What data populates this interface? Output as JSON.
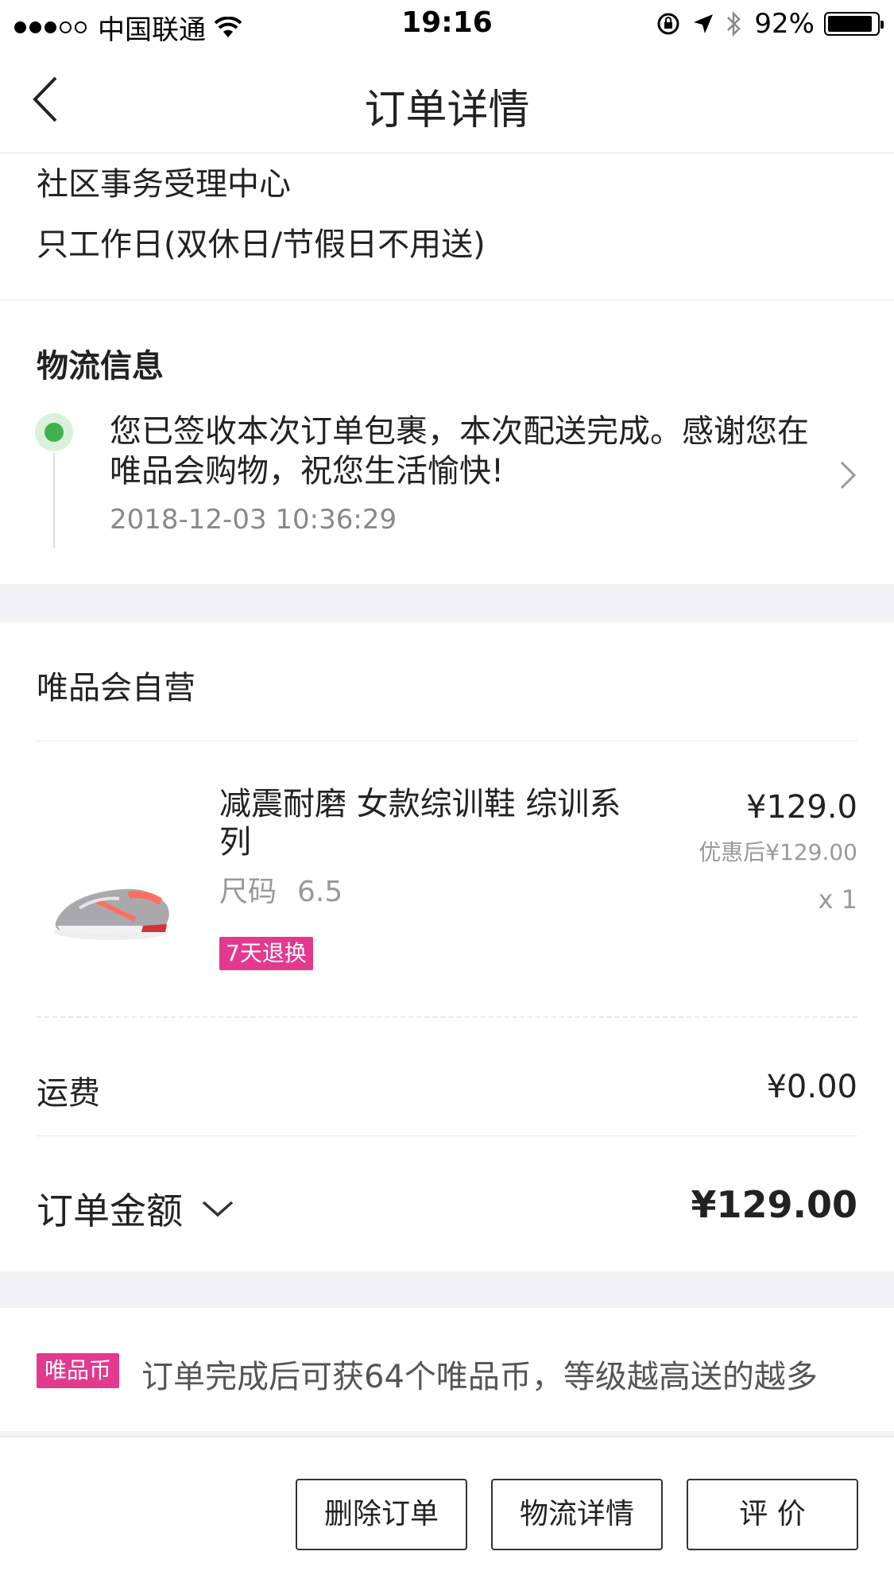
{
  "status_bar": {
    "carrier": "中国联通",
    "time": "19:16",
    "battery": "92%"
  },
  "nav": {
    "title": "订单详情"
  },
  "address": {
    "line1": "社区事务受理中心",
    "line2": "只工作日(双休日/节假日不用送)"
  },
  "logistics": {
    "title": "物流信息",
    "message": "您已签收本次订单包裹，本次配送完成。感谢您在唯品会购物，祝您生活愉快!",
    "time": "2018-12-03 10:36:29"
  },
  "shop": {
    "name": "唯品会自营",
    "product": {
      "name": "减震耐磨 女款综训鞋 综训系列",
      "size_label": "尺码",
      "size_value": "6.5",
      "tag": "7天退换",
      "price": "¥129.0",
      "discount_price": "优惠后¥129.00",
      "quantity": "x 1"
    },
    "shipping_label": "运费",
    "shipping_value": "¥0.00",
    "total_label": "订单金额",
    "total_value": "¥129.00"
  },
  "coin": {
    "badge": "唯品币",
    "text": "订单完成后可获64个唯品币，等级越高送的越多"
  },
  "actions": {
    "delete": "删除订单",
    "logistics_detail": "物流详情",
    "review": "评 价"
  },
  "colors": {
    "accent": "#e3398f",
    "success": "#3fb24a"
  }
}
